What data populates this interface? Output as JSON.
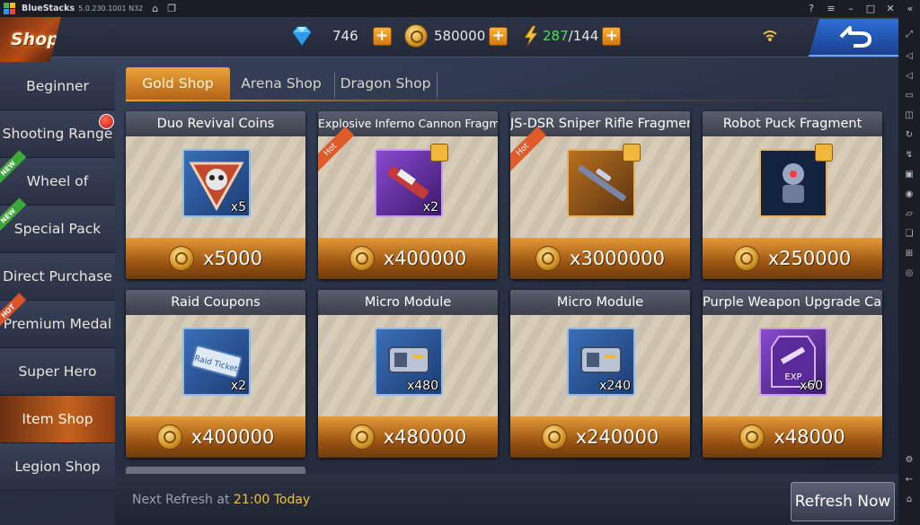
{
  "window": {
    "title": "BlueStacks",
    "version": "5.0.230.1001 N32",
    "logo_colors": [
      "#4caf50",
      "#ffc107",
      "#2196f3",
      "#f44336"
    ]
  },
  "header": {
    "shop_title": "Shop",
    "diamonds": "746",
    "gold": "580000",
    "energy_current": "287",
    "energy_max": "/144",
    "energy_color": "#4fe04f"
  },
  "sidebar": {
    "items": [
      {
        "label": "Beginner Special",
        "badge": ""
      },
      {
        "label": "Shooting Range",
        "badge": "dot"
      },
      {
        "label": "Wheel of Fortune",
        "badge": "NEW"
      },
      {
        "label": "Special Pack",
        "badge": "NEW"
      },
      {
        "label": "Direct Purchase",
        "badge": ""
      },
      {
        "label": "Premium Medal",
        "badge": "HOT"
      },
      {
        "label": "Super Hero",
        "badge": ""
      },
      {
        "label": "Item Shop",
        "badge": "",
        "active": true
      },
      {
        "label": "Legion Shop",
        "badge": ""
      }
    ]
  },
  "tabs": [
    {
      "label": "Gold Shop",
      "active": true
    },
    {
      "label": "Arena Shop",
      "active": false
    },
    {
      "label": "Dragon Shop",
      "active": false
    }
  ],
  "items": [
    {
      "title": "Duo Revival Coins",
      "qty": "x5",
      "price": "x5000",
      "frame": "blue",
      "hot": false,
      "fragment": false
    },
    {
      "title": "Explosive Inferno Cannon Fragment",
      "qty": "x2",
      "price": "x400000",
      "frame": "purple",
      "hot": true,
      "fragment": true
    },
    {
      "title": "JS-DSR Sniper Rifle Fragment",
      "qty": "",
      "price": "x3000000",
      "frame": "orange",
      "hot": true,
      "fragment": true
    },
    {
      "title": "Robot Puck Fragment",
      "qty": "",
      "price": "x250000",
      "frame": "orange",
      "hot": false,
      "fragment": true
    },
    {
      "title": "Raid Coupons",
      "qty": "x2",
      "price": "x400000",
      "frame": "blue",
      "hot": false,
      "fragment": false
    },
    {
      "title": "Micro Module",
      "qty": "x480",
      "price": "x480000",
      "frame": "blue",
      "hot": false,
      "fragment": false
    },
    {
      "title": "Micro Module",
      "qty": "x240",
      "price": "x240000",
      "frame": "blue",
      "hot": false,
      "fragment": false
    },
    {
      "title": "Purple Weapon Upgrade Card",
      "qty": "x60",
      "price": "x48000",
      "frame": "purple",
      "hot": false,
      "fragment": false
    }
  ],
  "item_tags": {
    "hot": "Hot",
    "ticket_text": "Raid Ticket",
    "exp_text": "EXP"
  },
  "footer": {
    "refresh_prefix": "Next Refresh at",
    "refresh_time": "21:00 Today",
    "refresh_button": "Refresh Now"
  }
}
